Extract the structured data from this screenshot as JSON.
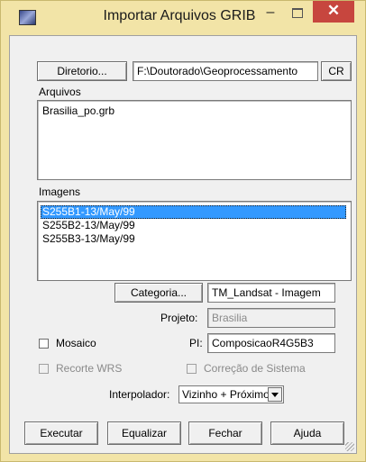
{
  "window": {
    "title": "Importar Arquivos GRIB",
    "minimize_glyph": "–",
    "close_glyph": "✕"
  },
  "diretorio": {
    "button_label": "Diretorio...",
    "path": "F:\\Doutorado\\Geoprocessamento",
    "cr_label": "CR"
  },
  "arquivos": {
    "label": "Arquivos",
    "items": [
      "Brasilia_po.grb"
    ]
  },
  "imagens": {
    "label": "Imagens",
    "items": [
      "S255B1-13/May/99",
      "S255B2-13/May/99",
      "S255B3-13/May/99"
    ],
    "selected_index": 0
  },
  "categoria": {
    "button_label": "Categoria...",
    "value": "TM_Landsat - Imagem"
  },
  "projeto": {
    "label": "Projeto:",
    "value": "Brasilia"
  },
  "mosaico": {
    "label": "Mosaico",
    "checked": false
  },
  "pi": {
    "label": "PI:",
    "value": "ComposicaoR4G5B3"
  },
  "recorte": {
    "label": "Recorte WRS",
    "checked": false,
    "enabled": false
  },
  "correcao": {
    "label": "Correção de Sistema",
    "checked": false,
    "enabled": false
  },
  "interpolador": {
    "label": "Interpolador:",
    "value": "Vizinho + Próximo"
  },
  "buttons": {
    "executar": "Executar",
    "equalizar": "Equalizar",
    "fechar": "Fechar",
    "ajuda": "Ajuda"
  },
  "colors": {
    "frame": "#f2e4a7",
    "close": "#c7463e",
    "selection": "#3399ff",
    "dialog": "#f0f0f0"
  }
}
